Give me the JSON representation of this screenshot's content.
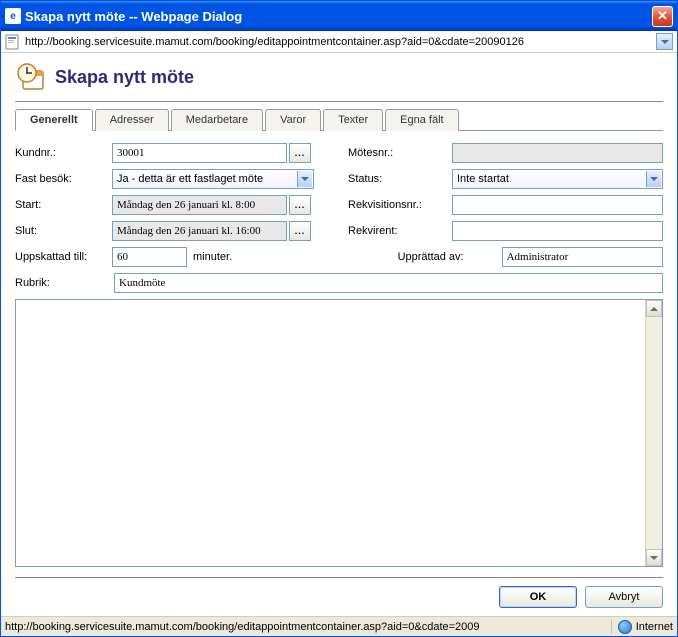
{
  "window": {
    "title": "Skapa nytt möte -- Webpage Dialog",
    "url": "http://booking.servicesuite.mamut.com/booking/editappointmentcontainer.asp?aid=0&cdate=20090126"
  },
  "header": {
    "title": "Skapa nytt möte"
  },
  "tabs": [
    {
      "label": "Generellt",
      "active": true
    },
    {
      "label": "Adresser",
      "active": false
    },
    {
      "label": "Medarbetare",
      "active": false
    },
    {
      "label": "Varor",
      "active": false
    },
    {
      "label": "Texter",
      "active": false
    },
    {
      "label": "Egna fält",
      "active": false
    }
  ],
  "form": {
    "kundnr_label": "Kundnr.:",
    "kundnr_value": "30001",
    "motesnr_label": "Mötesnr.:",
    "motesnr_value": "",
    "fastbesok_label": "Fast besök:",
    "fastbesok_value": "Ja - detta är ett fastlaget möte",
    "status_label": "Status:",
    "status_value": "Inte startat",
    "start_label": "Start:",
    "start_value": "Måndag den 26 januari kl. 8:00",
    "rekvisitionsnr_label": "Rekvisitionsnr.:",
    "rekvisitionsnr_value": "",
    "slut_label": "Slut:",
    "slut_value": "Måndag den 26 januari kl. 16:00",
    "rekvirent_label": "Rekvirent:",
    "rekvirent_value": "",
    "uppskattad_label": "Uppskattad till:",
    "uppskattad_value": "60",
    "uppskattad_unit": "minuter.",
    "upprattad_label": "Upprättad av:",
    "upprattad_value": "Administrator",
    "rubrik_label": "Rubrik:",
    "rubrik_value": "Kundmöte",
    "notes_value": ""
  },
  "picker_label": "...",
  "buttons": {
    "ok": "OK",
    "cancel": "Avbryt"
  },
  "statusbar": {
    "text": "http://booking.servicesuite.mamut.com/booking/editappointmentcontainer.asp?aid=0&cdate=2009",
    "zone": "Internet"
  }
}
